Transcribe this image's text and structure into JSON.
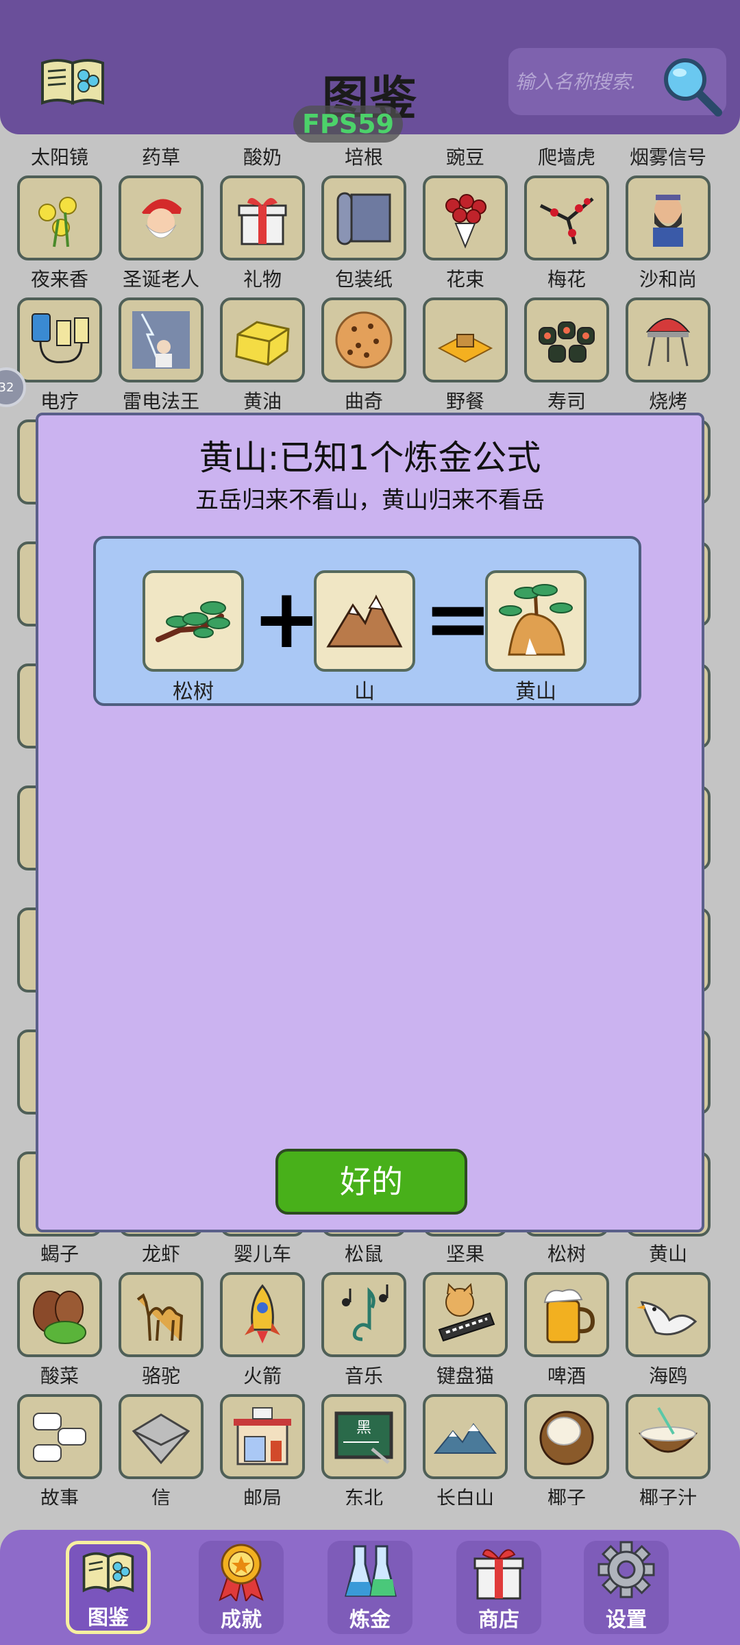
{
  "header": {
    "title": "图鉴",
    "fps": "FPS59",
    "search_placeholder": "输入名称搜索."
  },
  "grid": {
    "row0_labels": [
      "太阳镜",
      "药草",
      "酸奶",
      "培根",
      "豌豆",
      "爬墙虎",
      "烟雾信号"
    ],
    "rows": [
      {
        "items": [
          {
            "label": "夜来香",
            "icon": "flower-icon"
          },
          {
            "label": "圣诞老人",
            "icon": "santa-icon"
          },
          {
            "label": "礼物",
            "icon": "gift-icon"
          },
          {
            "label": "包装纸",
            "icon": "wrapping-paper-icon"
          },
          {
            "label": "花束",
            "icon": "bouquet-icon"
          },
          {
            "label": "梅花",
            "icon": "plum-blossom-icon"
          },
          {
            "label": "沙和尚",
            "icon": "monk-icon"
          }
        ]
      },
      {
        "items": [
          {
            "label": "电疗",
            "icon": "electrotherapy-icon"
          },
          {
            "label": "雷电法王",
            "icon": "lightning-king-icon"
          },
          {
            "label": "黄油",
            "icon": "butter-icon"
          },
          {
            "label": "曲奇",
            "icon": "cookie-icon"
          },
          {
            "label": "野餐",
            "icon": "picnic-icon"
          },
          {
            "label": "寿司",
            "icon": "sushi-icon"
          },
          {
            "label": "烧烤",
            "icon": "grill-icon"
          }
        ]
      }
    ],
    "row_after_dialog_labels": [
      "蝎子",
      "龙虾",
      "婴儿车",
      "松鼠",
      "坚果",
      "松树",
      "黄山"
    ],
    "rows_bottom": [
      {
        "items": [
          {
            "label": "酸菜",
            "icon": "pickled-cabbage-icon"
          },
          {
            "label": "骆驼",
            "icon": "camel-icon"
          },
          {
            "label": "火箭",
            "icon": "rocket-icon"
          },
          {
            "label": "音乐",
            "icon": "music-icon"
          },
          {
            "label": "键盘猫",
            "icon": "keyboard-cat-icon"
          },
          {
            "label": "啤酒",
            "icon": "beer-icon"
          },
          {
            "label": "海鸥",
            "icon": "seagull-icon"
          }
        ]
      },
      {
        "items": [
          {
            "label": "故事",
            "icon": "story-icon"
          },
          {
            "label": "信",
            "icon": "letter-icon"
          },
          {
            "label": "邮局",
            "icon": "post-office-icon"
          },
          {
            "label": "东北",
            "icon": "northeast-icon"
          },
          {
            "label": "长白山",
            "icon": "changbai-mountain-icon"
          },
          {
            "label": "椰子",
            "icon": "coconut-icon"
          },
          {
            "label": "椰子汁",
            "icon": "coconut-juice-icon"
          }
        ]
      }
    ]
  },
  "side_badge": "32",
  "dialog": {
    "title": "黄山:已知1个炼金公式",
    "subtitle": "五岳归来不看山，黄山归来不看岳",
    "formula": {
      "input1": {
        "label": "松树",
        "icon": "pine-tree-icon"
      },
      "plus": "+",
      "input2": {
        "label": "山",
        "icon": "mountain-icon"
      },
      "equals": "=",
      "output": {
        "label": "黄山",
        "icon": "huangshan-icon"
      }
    },
    "ok_label": "好的"
  },
  "nav": {
    "items": [
      {
        "label": "图鉴",
        "icon": "book-icon",
        "active": true
      },
      {
        "label": "成就",
        "icon": "medal-icon"
      },
      {
        "label": "炼金",
        "icon": "flask-icon"
      },
      {
        "label": "商店",
        "icon": "gift-shop-icon"
      },
      {
        "label": "设置",
        "icon": "gear-icon"
      }
    ]
  },
  "colors": {
    "header": "#6a4f9a",
    "dialog_bg": "#cbb3f0",
    "formula_bg": "#aac8f5",
    "ok_button": "#48b01a",
    "nav": "#8e6bc9",
    "fps_text": "#4cd26a"
  }
}
